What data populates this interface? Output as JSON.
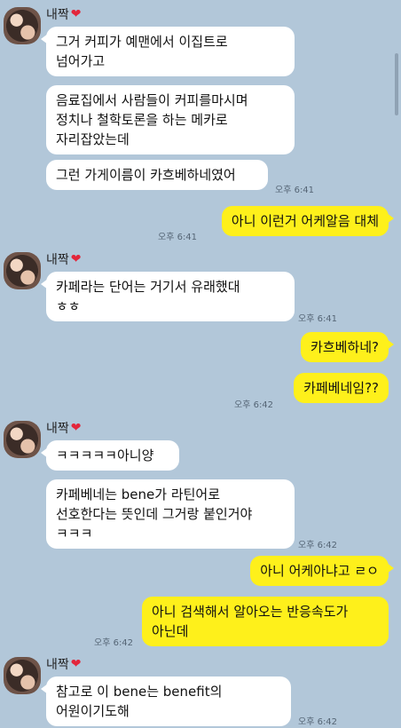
{
  "sender": {
    "name": "내짝",
    "icon": "heart-icon"
  },
  "messages_block1": [
    "그거 커피가 예맨에서 이집트로\n넘어가고",
    "음료집에서 사람들이 커피를마시며\n정치나 철학토론을 하는 메카로\n자리잡았는데",
    "그런 가게이름이 카흐베하네였어"
  ],
  "time1": "오후 6:41",
  "out1": "아니 이런거 어케알음 대체",
  "time2": "오후 6:41",
  "messages_block2": [
    "카페라는 단어는 거기서 유래했대\nㅎㅎ"
  ],
  "time3": "오후 6:41",
  "out2": [
    "카흐베하네?",
    "카페베네임??"
  ],
  "time4": "오후 6:42",
  "messages_block3": [
    "ㅋㅋㅋㅋㅋ아니양",
    "카페베네는 bene가 라틴어로\n선호한다는 뜻인데 그거랑 붙인거야\nㅋㅋㅋ"
  ],
  "time5": "오후 6:42",
  "out3": [
    "아니 어케아냐고 ㄹㅇ",
    "아니 검색해서 알아오는 반응속도가\n아닌데"
  ],
  "time6": "오후 6:42",
  "messages_block4": [
    "참고로 이 bene는 benefit의\n어원이기도해"
  ],
  "time7": "오후 6:42"
}
